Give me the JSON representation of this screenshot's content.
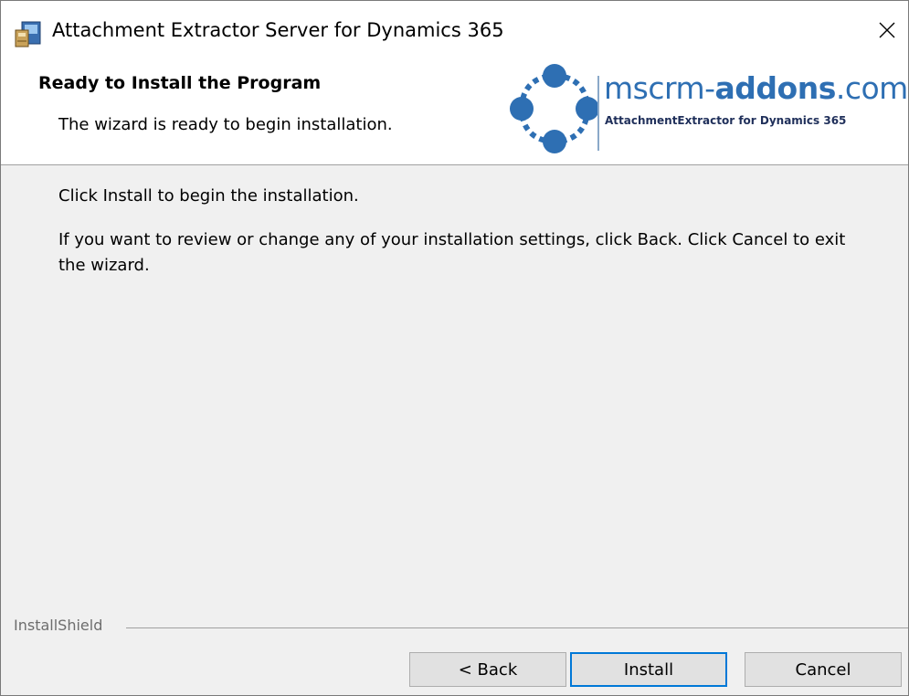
{
  "window": {
    "title": "Attachment Extractor Server for Dynamics 365",
    "app_icon": "installer-icon",
    "close_icon": "close-icon"
  },
  "header": {
    "title": "Ready to Install the Program",
    "subtitle": "The wizard is ready to begin installation.",
    "logo": {
      "brand_prefix": "mscrm-",
      "brand_bold": "addons",
      "brand_suffix": ".com",
      "tagline": "AttachmentExtractor for Dynamics 365"
    }
  },
  "body": {
    "line1": "Click Install to begin the installation.",
    "line2": "If you want to review or change any of your installation settings, click Back. Click Cancel to exit the wizard."
  },
  "footer": {
    "brand": "InstallShield"
  },
  "buttons": {
    "back": "< Back",
    "install": "Install",
    "cancel": "Cancel"
  },
  "colors": {
    "logo_blue": "#2e6fb3",
    "focus_blue": "#0078d7",
    "dialog_bg": "#f0f0f0"
  }
}
